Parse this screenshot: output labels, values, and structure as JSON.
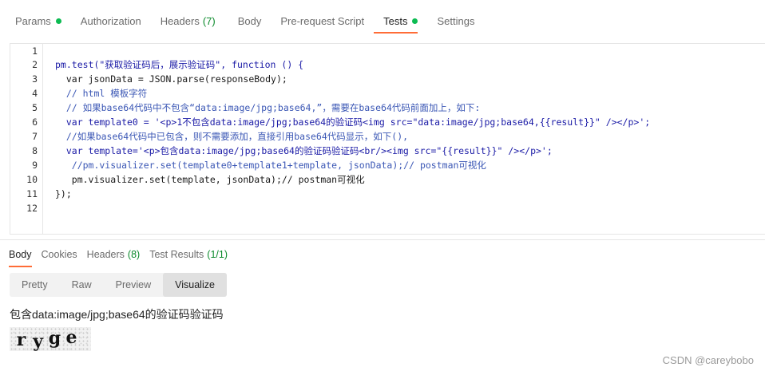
{
  "request_tabs": [
    {
      "label": "Params",
      "status_dot": true
    },
    {
      "label": "Authorization"
    },
    {
      "label": "Headers",
      "count": "(7)"
    },
    {
      "label": "Body"
    },
    {
      "label": "Pre-request Script"
    },
    {
      "label": "Tests",
      "status_dot": true,
      "active": true
    },
    {
      "label": "Settings"
    }
  ],
  "editor": {
    "line_numbers": [
      "1",
      "2",
      "3",
      "4",
      "5",
      "6",
      "7",
      "8",
      "9",
      "10",
      "11",
      "12"
    ],
    "lines": [
      "",
      "pm.test(\"获取验证码后，展示验证码\", function () {",
      "  var jsonData = JSON.parse(responseBody);",
      "  // html 模板字符",
      "  // 如果base64代码中不包含“data:image/jpg;base64,”，需要在base64代码前面加上，如下:",
      "  var template0 = '<p>1不包含data:image/jpg;base64的验证码<img src=\"data:image/jpg;base64,{{result}}\" /></p>';",
      "  //如果base64代码中已包含，则不需要添加，直接引用base64代码显示，如下(),",
      "  var template='<p>包含data:image/jpg;base64的验证码验证码<br/><img src=\"{{result}}\" /></p>';",
      "   //pm.visualizer.set(template0+template1+template, jsonData);// postman可视化",
      "   pm.visualizer.set(template, jsonData);// postman可视化",
      "});",
      ""
    ]
  },
  "response_tabs": [
    {
      "label": "Body",
      "active": true
    },
    {
      "label": "Cookies"
    },
    {
      "label": "Headers",
      "count": "(8)"
    },
    {
      "label": "Test Results",
      "count": "(1/1)"
    }
  ],
  "view_modes": [
    {
      "label": "Pretty"
    },
    {
      "label": "Raw"
    },
    {
      "label": "Preview"
    },
    {
      "label": "Visualize",
      "active": true
    }
  ],
  "visualize": {
    "text": "包含data:image/jpg;base64的验证码验证码",
    "captcha_chars": [
      "r",
      "y",
      "g",
      "e"
    ]
  },
  "watermark": "CSDN @careybobo",
  "colors": {
    "accent": "#ff6c37",
    "status_dot": "#0cbb52",
    "count_text": "#0b8a2b"
  }
}
